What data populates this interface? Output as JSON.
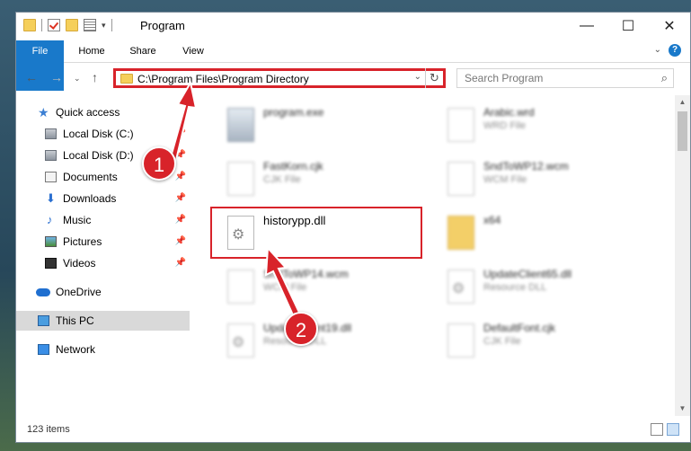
{
  "window": {
    "title": "Program"
  },
  "ribbon": {
    "tabs": [
      "File",
      "Home",
      "Share",
      "View"
    ]
  },
  "address": {
    "path": "C:\\Program Files\\Program Directory"
  },
  "search": {
    "placeholder": "Search Program"
  },
  "nav": {
    "quick_access": "Quick access",
    "items": [
      {
        "label": "Local Disk (C:)"
      },
      {
        "label": "Local Disk (D:)"
      },
      {
        "label": "Documents"
      },
      {
        "label": "Downloads"
      },
      {
        "label": "Music"
      },
      {
        "label": "Pictures"
      },
      {
        "label": "Videos"
      }
    ],
    "onedrive": "OneDrive",
    "thispc": "This PC",
    "network": "Network"
  },
  "files": [
    {
      "name": "program.exe",
      "type": ""
    },
    {
      "name": "Arabic.wrd",
      "type": "WRD File"
    },
    {
      "name": "FastKorn.cjk",
      "type": "CJK File"
    },
    {
      "name": "SndToWP12.wcm",
      "type": "WCM File"
    },
    {
      "name": "historypp.dll",
      "type": ""
    },
    {
      "name": "x64",
      "type": ""
    },
    {
      "name": "SndToWP14.wcm",
      "type": "WCM File"
    },
    {
      "name": "UpdateClient65.dll",
      "type": "Resource DLL"
    },
    {
      "name": "UpdateClient19.dll",
      "type": "Resource DLL"
    },
    {
      "name": "DefaultFont.cjk",
      "type": "CJK File"
    }
  ],
  "status": {
    "count": "123 items"
  },
  "callouts": [
    "1",
    "2"
  ],
  "colors": {
    "accent": "#1979ca",
    "highlight": "#d8232a"
  }
}
